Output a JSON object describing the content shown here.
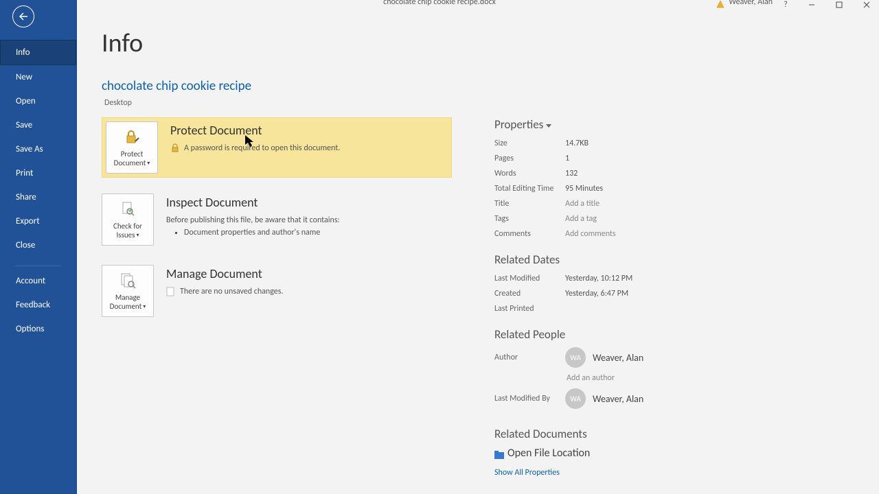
{
  "window": {
    "title": "chocolate chip cookie recipe.docx",
    "user": "Weaver, Alan",
    "help": "?"
  },
  "sidebar": {
    "items": [
      "Info",
      "New",
      "Open",
      "Save",
      "Save As",
      "Print",
      "Share",
      "Export",
      "Close"
    ],
    "footer": [
      "Account",
      "Feedback",
      "Options"
    ]
  },
  "header": {
    "page_title": "Info",
    "doc_title": "chocolate chip cookie recipe",
    "doc_location": "Desktop"
  },
  "cards": {
    "protect": {
      "button_l1": "Protect",
      "button_l2": "Document",
      "title": "Protect Document",
      "message": "A password is required to open this document."
    },
    "inspect": {
      "button_l1": "Check for",
      "button_l2": "Issues",
      "title": "Inspect Document",
      "intro": "Before publishing this file, be aware that it contains:",
      "bullet1": "Document properties and author's name"
    },
    "manage": {
      "button_l1": "Manage",
      "button_l2": "Document",
      "title": "Manage Document",
      "message": "There are no unsaved changes."
    }
  },
  "props": {
    "heading": "Properties",
    "rows": {
      "size_l": "Size",
      "size_v": "14.7KB",
      "pages_l": "Pages",
      "pages_v": "1",
      "words_l": "Words",
      "words_v": "132",
      "time_l": "Total Editing Time",
      "time_v": "95 Minutes",
      "title_l": "Title",
      "title_v": "Add a title",
      "tags_l": "Tags",
      "tags_v": "Add a tag",
      "comments_l": "Comments",
      "comments_v": "Add comments"
    }
  },
  "dates": {
    "heading": "Related Dates",
    "modified_l": "Last Modified",
    "modified_v": "Yesterday, 10:12 PM",
    "created_l": "Created",
    "created_v": "Yesterday, 6:47 PM",
    "printed_l": "Last Printed",
    "printed_v": ""
  },
  "people": {
    "heading": "Related People",
    "author_l": "Author",
    "author_initials": "WA",
    "author_name": "Weaver, Alan",
    "add_author": "Add an author",
    "lastmod_l": "Last Modified By",
    "lastmod_initials": "WA",
    "lastmod_name": "Weaver, Alan"
  },
  "docs": {
    "heading": "Related Documents",
    "open_location": "Open File Location",
    "show_all": "Show All Properties"
  }
}
